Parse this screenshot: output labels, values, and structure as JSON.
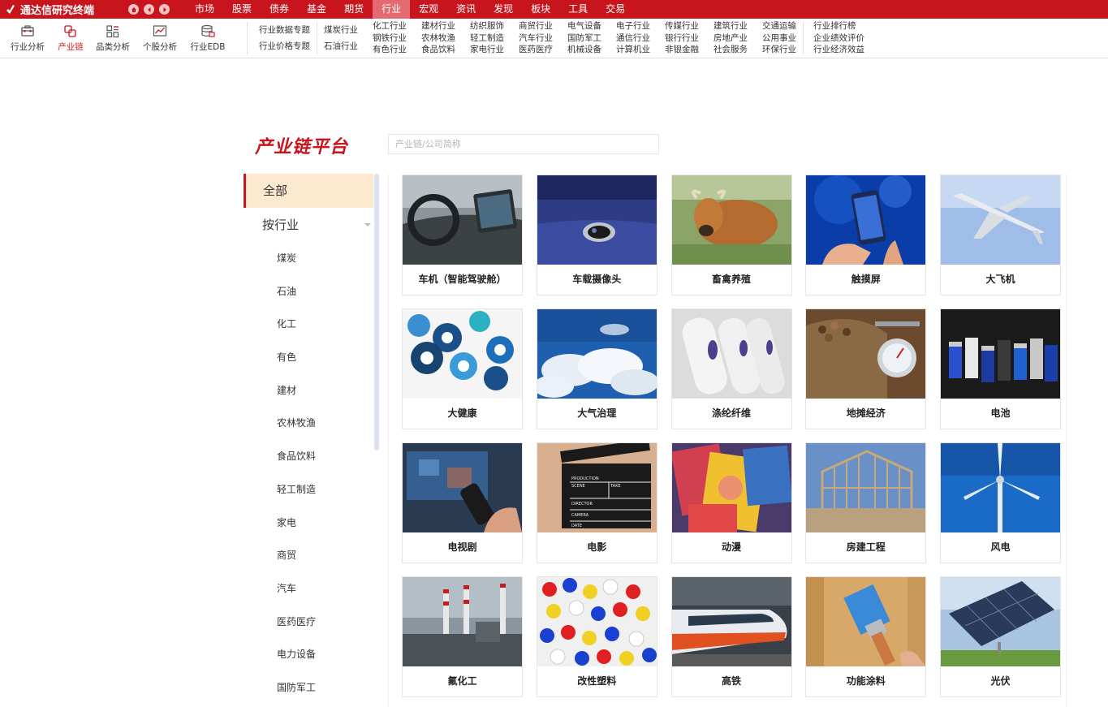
{
  "app": {
    "title": "通达信研究终端"
  },
  "menu": [
    "市场",
    "股票",
    "债券",
    "基金",
    "期货",
    "行业",
    "宏观",
    "资讯",
    "发现",
    "板块",
    "工具",
    "交易"
  ],
  "menu_active": "行业",
  "tools": [
    {
      "label": "行业分析",
      "icon": "toolbox-icon"
    },
    {
      "label": "产业链",
      "icon": "chain-icon",
      "active": true
    },
    {
      "label": "品类分析",
      "icon": "grid-icon"
    },
    {
      "label": "个股分析",
      "icon": "line-chart-icon"
    },
    {
      "label": "行业EDB",
      "icon": "database-icon"
    }
  ],
  "topics": [
    "行业数据专题",
    "行业价格专题"
  ],
  "industry_cols": [
    [
      "煤炭行业",
      "石油行业"
    ],
    [
      "化工行业",
      "钢铁行业",
      "有色行业"
    ],
    [
      "建材行业",
      "农林牧渔",
      "食品饮料"
    ],
    [
      "纺织服饰",
      "轻工制造",
      "家电行业"
    ],
    [
      "商贸行业",
      "汽车行业",
      "医药医疗"
    ],
    [
      "电气设备",
      "国防军工",
      "机械设备"
    ],
    [
      "电子行业",
      "通信行业",
      "计算机业"
    ],
    [
      "传媒行业",
      "银行行业",
      "非银金融"
    ],
    [
      "建筑行业",
      "房地产业",
      "社会服务"
    ],
    [
      "交通运输",
      "公用事业",
      "环保行业"
    ]
  ],
  "rank_col": [
    "行业排行榜",
    "企业绩效评价",
    "行业经济效益"
  ],
  "platform": {
    "title": "产业链平台",
    "search_placeholder": "产业链/公司简称"
  },
  "sidebar": {
    "all": "全部",
    "group": "按行业",
    "items": [
      "煤炭",
      "石油",
      "化工",
      "有色",
      "建材",
      "农林牧渔",
      "食品饮料",
      "轻工制造",
      "家电",
      "商贸",
      "汽车",
      "医药医疗",
      "电力设备",
      "国防军工"
    ]
  },
  "cards": [
    {
      "label": "车机（智能驾驶舱）",
      "img": "car-cockpit"
    },
    {
      "label": "车载摄像头",
      "img": "car-camera"
    },
    {
      "label": "畜禽养殖",
      "img": "cattle"
    },
    {
      "label": "触摸屏",
      "img": "touchscreen"
    },
    {
      "label": "大飞机",
      "img": "airplane"
    },
    {
      "label": "大健康",
      "img": "health-gears"
    },
    {
      "label": "大气治理",
      "img": "sky-clouds"
    },
    {
      "label": "涤纶纤维",
      "img": "fiber-spools"
    },
    {
      "label": "地摊经济",
      "img": "street-scale"
    },
    {
      "label": "电池",
      "img": "batteries"
    },
    {
      "label": "电视剧",
      "img": "tv-remote"
    },
    {
      "label": "电影",
      "img": "clapperboard"
    },
    {
      "label": "动漫",
      "img": "comics"
    },
    {
      "label": "房建工程",
      "img": "house-frame"
    },
    {
      "label": "风电",
      "img": "wind-turbine"
    },
    {
      "label": "氟化工",
      "img": "chemical-plant"
    },
    {
      "label": "改性塑料",
      "img": "plastic-pellets"
    },
    {
      "label": "高铁",
      "img": "bullet-train"
    },
    {
      "label": "功能涂料",
      "img": "paint-brush"
    },
    {
      "label": "光伏",
      "img": "solar-panel"
    }
  ],
  "clapper_text": [
    "PRODUCTION",
    "SCENE",
    "TAKE",
    "DIRECTOR",
    "CAMERA",
    "DATE"
  ],
  "colors": {
    "brand": "#c8141c",
    "menu_active": "#e36a70",
    "sidebar_active_bg": "#fde8d0"
  }
}
